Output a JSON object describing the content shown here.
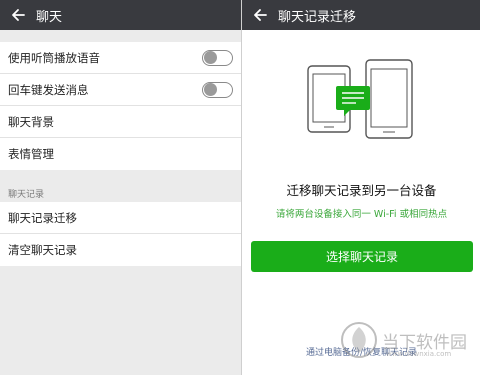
{
  "left": {
    "title": "聊天",
    "settings": [
      {
        "label": "使用听筒播放语音",
        "toggle_on": false
      },
      {
        "label": "回车键发送消息",
        "toggle_on": false
      },
      {
        "label": "聊天背景"
      },
      {
        "label": "表情管理"
      }
    ],
    "section_label": "聊天记录",
    "history_items": [
      "聊天记录迁移",
      "清空聊天记录"
    ]
  },
  "right": {
    "title": "聊天记录迁移",
    "headline": "迁移聊天记录到另一台设备",
    "hint": "请将两台设备接入同一 Wi-Fi 或相同热点",
    "select_button": "选择聊天记录",
    "pc_link": "通过电脑备份/恢复聊天记录"
  },
  "watermark": {
    "text": "当下软件园",
    "url": "www.downxia.com"
  },
  "colors": {
    "topbar": "#393a3f",
    "accent_green": "#1aad19",
    "hint_green": "#3aa73a",
    "link_blue": "#576b95",
    "bg_gray": "#ebebeb"
  },
  "icons": [
    "back-arrow-icon",
    "toggle-switch",
    "phones-transfer-illustration",
    "watermark-logo-icon"
  ]
}
